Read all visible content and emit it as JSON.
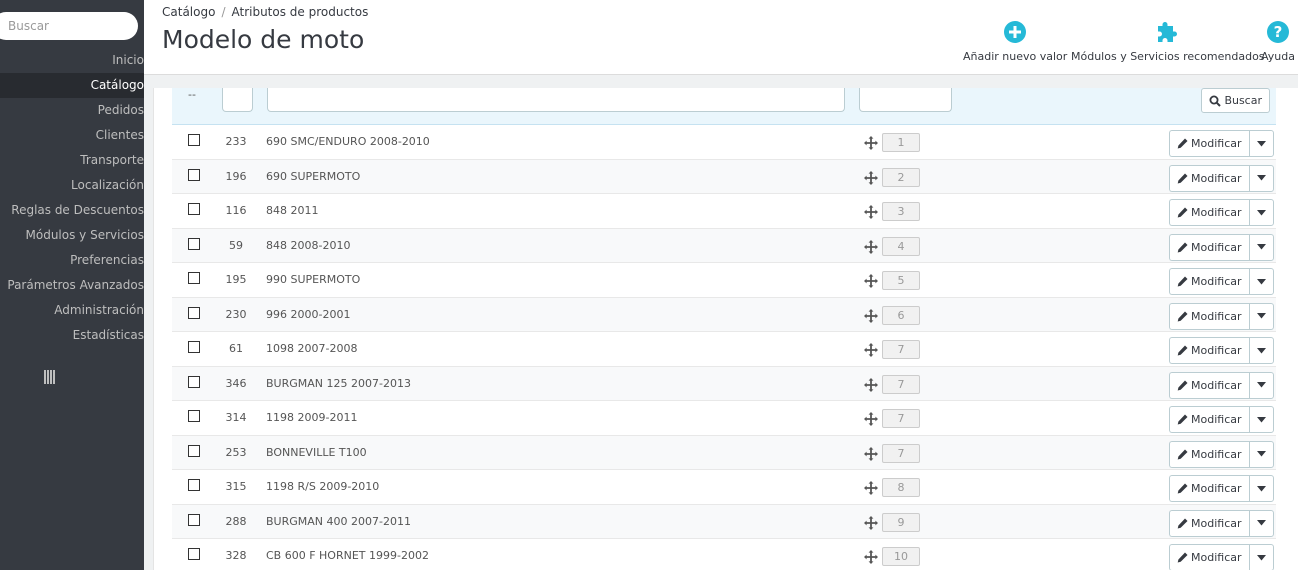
{
  "sidebar": {
    "search_placeholder": "Buscar",
    "items": [
      {
        "label": "Inicio",
        "active": false
      },
      {
        "label": "Catálogo",
        "active": true
      },
      {
        "label": "Pedidos",
        "active": false
      },
      {
        "label": "Clientes",
        "active": false
      },
      {
        "label": "Transporte",
        "active": false
      },
      {
        "label": "Localización",
        "active": false
      },
      {
        "label": "Reglas de Descuentos",
        "active": false
      },
      {
        "label": "Módulos y Servicios",
        "active": false
      },
      {
        "label": "Preferencias",
        "active": false
      },
      {
        "label": "Parámetros Avanzados",
        "active": false
      },
      {
        "label": "Administración",
        "active": false
      },
      {
        "label": "Estadísticas",
        "active": false
      }
    ]
  },
  "header": {
    "breadcrumb": [
      "Catálogo",
      "Atributos de productos"
    ],
    "breadcrumb_sep": "/",
    "title": "Modelo de moto",
    "actions": [
      {
        "label": "Añadir nuevo valor",
        "icon": "plus-circle-icon"
      },
      {
        "label": "Módulos y Servicios recomendados",
        "icon": "puzzle-icon"
      },
      {
        "label": "Ayuda",
        "icon": "help-icon"
      }
    ]
  },
  "filters": {
    "dash": "--",
    "search_label": "Buscar"
  },
  "table": {
    "edit_label": "Modificar",
    "rows": [
      {
        "id": "233",
        "name": "690 SMC/ENDURO 2008-2010",
        "position": "1"
      },
      {
        "id": "196",
        "name": "690 SUPERMOTO",
        "position": "2"
      },
      {
        "id": "116",
        "name": "848 2011",
        "position": "3"
      },
      {
        "id": "59",
        "name": "848 2008-2010",
        "position": "4"
      },
      {
        "id": "195",
        "name": "990 SUPERMOTO",
        "position": "5"
      },
      {
        "id": "230",
        "name": "996 2000-2001",
        "position": "6"
      },
      {
        "id": "61",
        "name": "1098 2007-2008",
        "position": "7"
      },
      {
        "id": "346",
        "name": "BURGMAN 125 2007-2013",
        "position": "7"
      },
      {
        "id": "314",
        "name": "1198 2009-2011",
        "position": "7"
      },
      {
        "id": "253",
        "name": "BONNEVILLE T100",
        "position": "7"
      },
      {
        "id": "315",
        "name": "1198 R/S 2009-2010",
        "position": "8"
      },
      {
        "id": "288",
        "name": "BURGMAN 400 2007-2011",
        "position": "9"
      },
      {
        "id": "328",
        "name": "CB 600 F HORNET 1999-2002",
        "position": "10"
      }
    ]
  },
  "colors": {
    "accent": "#25b9d7",
    "sidebar_bg": "#363a41"
  }
}
